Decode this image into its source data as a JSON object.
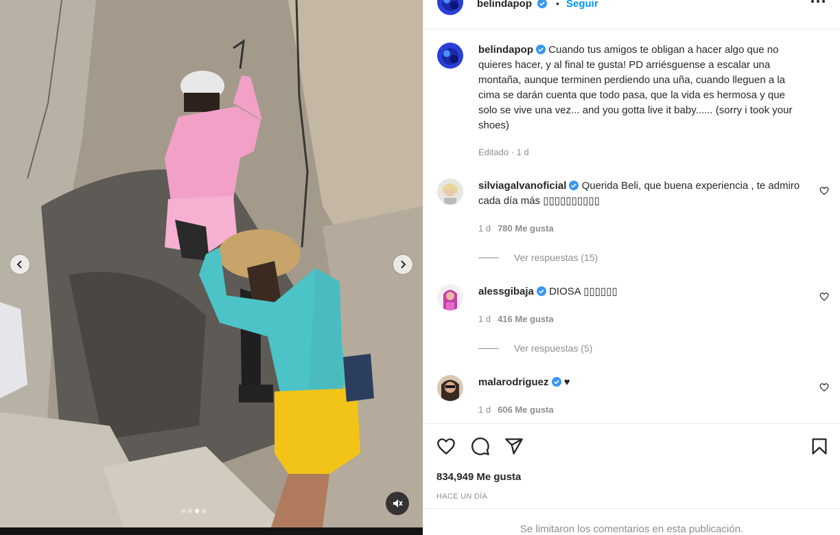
{
  "header": {
    "username": "belindapop",
    "separator": "•",
    "follow_label": "Seguir"
  },
  "caption": {
    "username": "belindapop",
    "text": "Cuando tus amigos te obligan a hacer algo que no quieres hacer, y al final te gusta! PD arriésguense a escalar una montaña, aunque terminen perdiendo una uña, cuando lleguen a la cima se darán cuenta que todo pasa, que la vida es hermosa y que solo se vive una vez... and you gotta live it baby...... (sorry i took your shoes)",
    "meta": "Editado · 1 d"
  },
  "comments": [
    {
      "username": "silviagalvanoficial",
      "text": "Querida Beli, que buena experiencia , te admiro cada día más ▯▯▯▯▯▯▯▯▯▯",
      "time": "1 d",
      "likes": "780 Me gusta",
      "replies": "Ver respuestas (15)"
    },
    {
      "username": "alessgibaja",
      "text": "DIOSA ▯▯▯▯▯▯",
      "time": "1 d",
      "likes": "416 Me gusta",
      "replies": "Ver respuestas (5)"
    },
    {
      "username": "malarodriguez",
      "text": "♥",
      "time": "1 d",
      "likes": "606 Me gusta",
      "replies": ""
    }
  ],
  "footer": {
    "likes": "834,949 Me gusta",
    "time": "HACE UN DÍA",
    "limited_note": "Se limitaron los comentarios en esta publicación."
  },
  "media": {
    "dots": 4,
    "active_dot": 2
  },
  "icons": [
    "verified-icon",
    "more-options-icon",
    "heart-icon",
    "comment-icon",
    "share-icon",
    "bookmark-icon",
    "chevron-left-icon",
    "chevron-right-icon",
    "mute-icon"
  ],
  "colors": {
    "accent": "#0095f6",
    "text": "#262626",
    "muted": "#8e8e8e",
    "border": "#efefef"
  }
}
